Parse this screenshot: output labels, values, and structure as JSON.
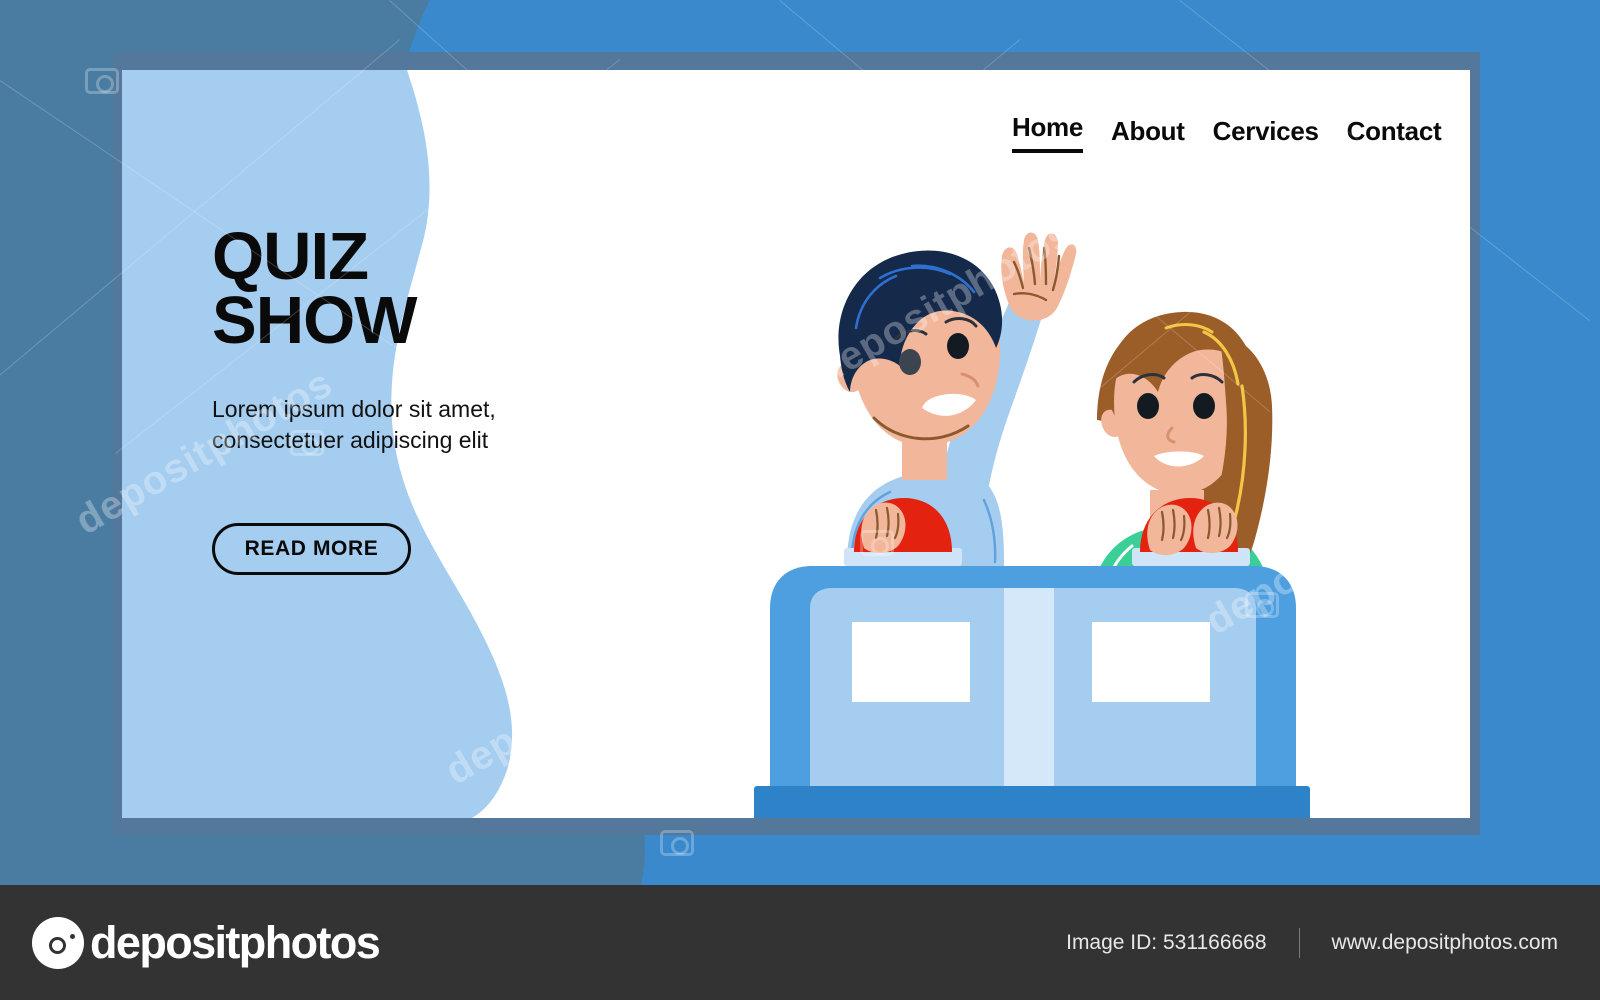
{
  "theme": {
    "outer_bg_right": "#3A89CC",
    "outer_bg_left": "#4A7CA2",
    "frame_border": "#53789B",
    "card_bg": "#FFFFFF",
    "wave_blue": "#A5CDF0",
    "accent_dark": "#0A0A0A",
    "podium_dark_blue": "#2E83C8",
    "podium_light_blue": "#A5CDF0",
    "buzzer_red": "#E32210",
    "boy_shirt": "#A5CDF0",
    "boy_hair": "#152A4A",
    "girl_sweater": "#3ACF96",
    "girl_hair": "#9B5E28",
    "skin": "#F2B79B",
    "footer_bg": "#333333"
  },
  "nav": {
    "items": [
      {
        "label": "Home",
        "active": true
      },
      {
        "label": "About",
        "active": false
      },
      {
        "label": "Cervices",
        "active": false
      },
      {
        "label": "Contact",
        "active": false
      }
    ]
  },
  "hero": {
    "title_line1": "QUIZ",
    "title_line2": "SHOW",
    "subtitle": "Lorem ipsum dolor sit amet, consectetuer adipiscing elit",
    "cta_label": "READ MORE"
  },
  "illustration": {
    "name": "quiz-show-contestants",
    "boy": {
      "name": "boy-contestant",
      "pose": "hand-raised"
    },
    "girl": {
      "name": "girl-contestant",
      "pose": "hands-on-buzzer"
    },
    "podium": {
      "name": "quiz-podium",
      "panels": 2
    },
    "buzzers": 2
  },
  "watermark": {
    "brand": "depositphotos",
    "tiles": [
      "depositphotos",
      "depositphotos",
      "depositphotos",
      "depositphotos"
    ]
  },
  "footer": {
    "brand": "depositphotos",
    "image_id": "Image ID: 531166668",
    "website": "www.depositphotos.com"
  }
}
